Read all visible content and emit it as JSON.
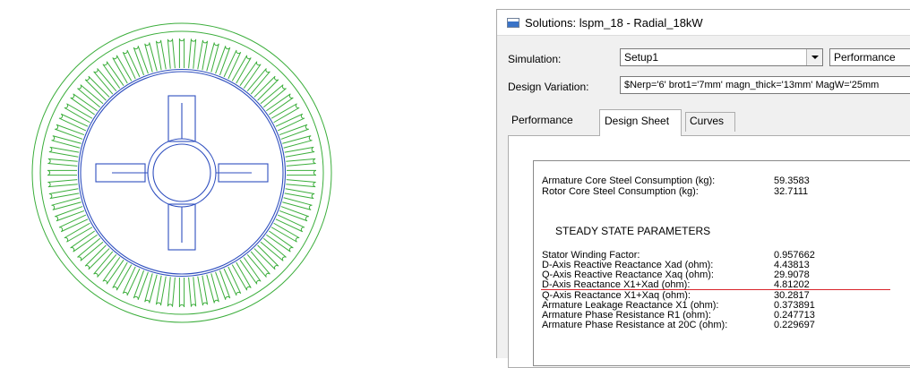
{
  "window": {
    "title": "Solutions: lspm_18 - Radial_18kW"
  },
  "simulation": {
    "label": "Simulation:",
    "setup_value": "Setup1",
    "type_value": "Performance"
  },
  "design_variation": {
    "label": "Design Variation:",
    "value": "$Nerp='6' brot1='7mm' magn_thick='13mm' MagW='25mm"
  },
  "tabs": [
    {
      "label": "Performance",
      "active": false
    },
    {
      "label": "Design Sheet",
      "active": true
    },
    {
      "label": "Curves",
      "active": false
    }
  ],
  "sheet": {
    "consumption": [
      {
        "label": "Armature Core Steel Consumption (kg):",
        "value": "59.3583"
      },
      {
        "label": "Rotor Core Steel Consumption (kg):",
        "value": "32.7111"
      }
    ],
    "section_header": "STEADY STATE PARAMETERS",
    "parameters": [
      {
        "label": "Stator Winding Factor:",
        "value": "0.957662"
      },
      {
        "label": "D-Axis Reactive Reactance Xad (ohm):",
        "value": "4.43813"
      },
      {
        "label": "Q-Axis Reactive Reactance Xaq (ohm):",
        "value": "29.9078"
      },
      {
        "label": "D-Axis Reactance X1+Xad (ohm):",
        "value": "4.81202"
      },
      {
        "label": "Q-Axis Reactance X1+Xaq (ohm):",
        "value": "30.2817"
      },
      {
        "label": "Armature Leakage Reactance X1 (ohm):",
        "value": "0.373891"
      },
      {
        "label": "Armature Phase Resistance R1 (ohm):",
        "value": "0.247713"
      },
      {
        "label": "Armature Phase Resistance at 20C (ohm):",
        "value": "0.229697"
      }
    ]
  },
  "colors": {
    "stator": "#3cae3c",
    "rotor": "#2f4fbf",
    "highlight_line": "#d9242c"
  }
}
